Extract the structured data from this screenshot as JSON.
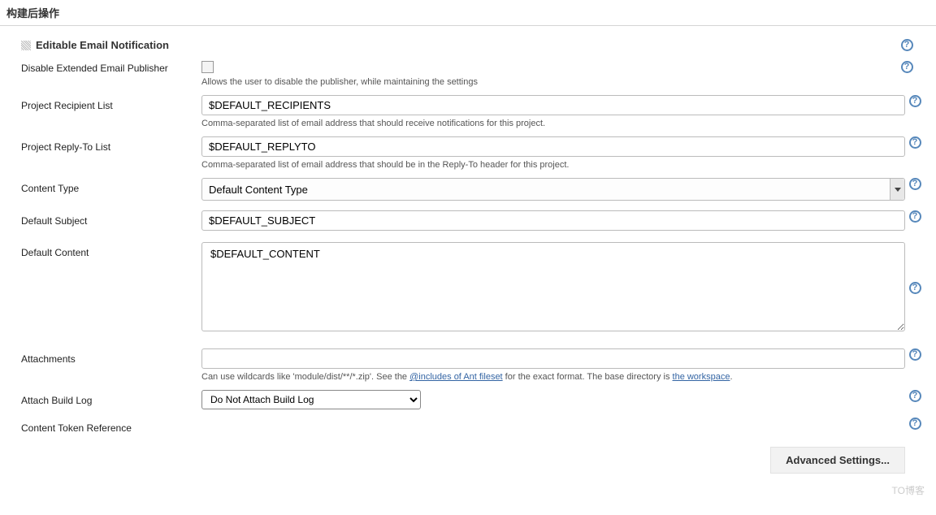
{
  "section_title": "构建后操作",
  "notification_title": "Editable Email Notification",
  "disable": {
    "label": "Disable Extended Email Publisher",
    "help": "Allows the user to disable the publisher, while maintaining the settings"
  },
  "recipient": {
    "label": "Project Recipient List",
    "value": "$DEFAULT_RECIPIENTS",
    "help": "Comma-separated list of email address that should receive notifications for this project."
  },
  "replyto": {
    "label": "Project Reply-To List",
    "value": "$DEFAULT_REPLYTO",
    "help": "Comma-separated list of email address that should be in the Reply-To header for this project."
  },
  "content_type": {
    "label": "Content Type",
    "value": "Default Content Type"
  },
  "subject": {
    "label": "Default Subject",
    "value": "$DEFAULT_SUBJECT"
  },
  "content": {
    "label": "Default Content",
    "value": "$DEFAULT_CONTENT"
  },
  "attachments": {
    "label": "Attachments",
    "value": "",
    "help_prefix": "Can use wildcards like 'module/dist/**/*.zip'. See the ",
    "help_link1": "@includes of Ant fileset",
    "help_mid": " for the exact format. The base directory is ",
    "help_link2": "the workspace",
    "help_suffix": "."
  },
  "attach_log": {
    "label": "Attach Build Log",
    "value": "Do Not Attach Build Log"
  },
  "token_ref": {
    "label": "Content Token Reference"
  },
  "advanced_button": "Advanced Settings...",
  "watermark": "TO博客"
}
